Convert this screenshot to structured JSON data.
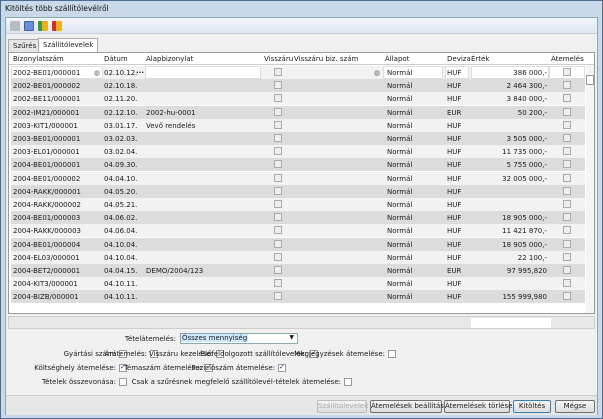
{
  "window": {
    "title": "Kitöltés több szállítólevélről"
  },
  "toolbar": {
    "icons": [
      "copy-icon",
      "table-icon",
      "import-icon",
      "export-icon"
    ]
  },
  "tabs": [
    {
      "label": "Szűrés",
      "active": false
    },
    {
      "label": "Szállítólevelek",
      "active": true
    }
  ],
  "grid": {
    "columns": [
      "Bizonylatszám",
      "Dátum",
      "Alapbizonylat",
      "Visszáru",
      "Visszáru biz. szám",
      "Állapot",
      "Deviza",
      "Érték",
      "Átemelés"
    ],
    "rows": [
      [
        "2002-BE01/000001",
        "02.10.12.",
        "",
        "",
        "Normál",
        "HUF",
        "386 000,-"
      ],
      [
        "2002-BE01/000002",
        "02.10.18.",
        "",
        "",
        "Normál",
        "HUF",
        "2 464 300,-"
      ],
      [
        "2002-BE11/000001",
        "02.11.20.",
        "",
        "",
        "Normál",
        "HUF",
        "3 840 000,-"
      ],
      [
        "2002-IM21/000001",
        "02.12.10.",
        "2002-hu-0001",
        "",
        "Normál",
        "EUR",
        "50 200,-"
      ],
      [
        "2003-KIT1/000001",
        "03.01.17.",
        "Vevő rendelés",
        "",
        "Normál",
        "HUF",
        ""
      ],
      [
        "2003-BE01/000001",
        "03.02.03.",
        "",
        "",
        "Normál",
        "HUF",
        "3 505 000,-"
      ],
      [
        "2003-EL01/000001",
        "03.02.04.",
        "",
        "",
        "Normál",
        "HUF",
        "11 735 000,-"
      ],
      [
        "2004-BE01/000001",
        "04.09.30.",
        "",
        "",
        "Normál",
        "HUF",
        "5 755 000,-"
      ],
      [
        "2004-BE01/000002",
        "04.04.10.",
        "",
        "",
        "Normál",
        "HUF",
        "32 005 000,-"
      ],
      [
        "2004-RAKK/000001",
        "04.05.20.",
        "",
        "",
        "Normál",
        "HUF",
        ""
      ],
      [
        "2004-RAKK/000002",
        "04.05.21.",
        "",
        "",
        "Normál",
        "HUF",
        ""
      ],
      [
        "2004-BE01/000003",
        "04.06.02.",
        "",
        "",
        "Normál",
        "HUF",
        "18 905 000,-"
      ],
      [
        "2004-RAKK/000003",
        "04.06.04.",
        "",
        "",
        "Normál",
        "HUF",
        "11 421 870,-"
      ],
      [
        "2004-BE01/000004",
        "04.10.04.",
        "",
        "",
        "Normál",
        "HUF",
        "18 905 000,-"
      ],
      [
        "2004-EL03/000001",
        "04.10.04.",
        "",
        "",
        "Normál",
        "HUF",
        "22 100,-"
      ],
      [
        "2004-BET2/000001",
        "04.04.15.",
        "DEMO/2004/123",
        "",
        "Normál",
        "EUR",
        "97 995,820"
      ],
      [
        "2004-KIT3/000001",
        "04.10.11.",
        "",
        "",
        "Normál",
        "HUF",
        ""
      ],
      [
        "2004-BIZB/000001",
        "04.10.11.",
        "",
        "",
        "Normál",
        "HUF",
        "155 999,980"
      ]
    ],
    "ellipsis": "..."
  },
  "form": {
    "tetelatemeles_label": "Tételátemelés:",
    "tetelatemeles_value": "Összes mennyiség",
    "checks": [
      {
        "label": "Gyártási szám:",
        "checked": false
      },
      {
        "label": "Árátemelés:",
        "checked": false
      },
      {
        "label": "Visszáru kezelése:",
        "checked": false
      },
      {
        "label": "Előfeldolgozott szállítólevelek:",
        "checked": true
      },
      {
        "label": "Megjegyzések átemelése:",
        "checked": false
      },
      {
        "label": "Költséghely átemelése:",
        "checked": true
      },
      {
        "label": "Témaszám átemelése:",
        "checked": true
      },
      {
        "label": "Pozíciószám átemelése:",
        "checked": true
      },
      {
        "label": "Tételek összevonása:",
        "checked": false
      },
      {
        "label": "Csak a szűrésnek megfelelő szállítólevél-tételek átemelése:",
        "checked": false
      }
    ]
  },
  "buttons": {
    "szallitolevelek": "Szállítólevelek",
    "beallitasa": "Átemelések beállítása",
    "torlese": "Átemelések törlése",
    "kitoltes": "Kitöltés",
    "megse": "Mégse"
  }
}
